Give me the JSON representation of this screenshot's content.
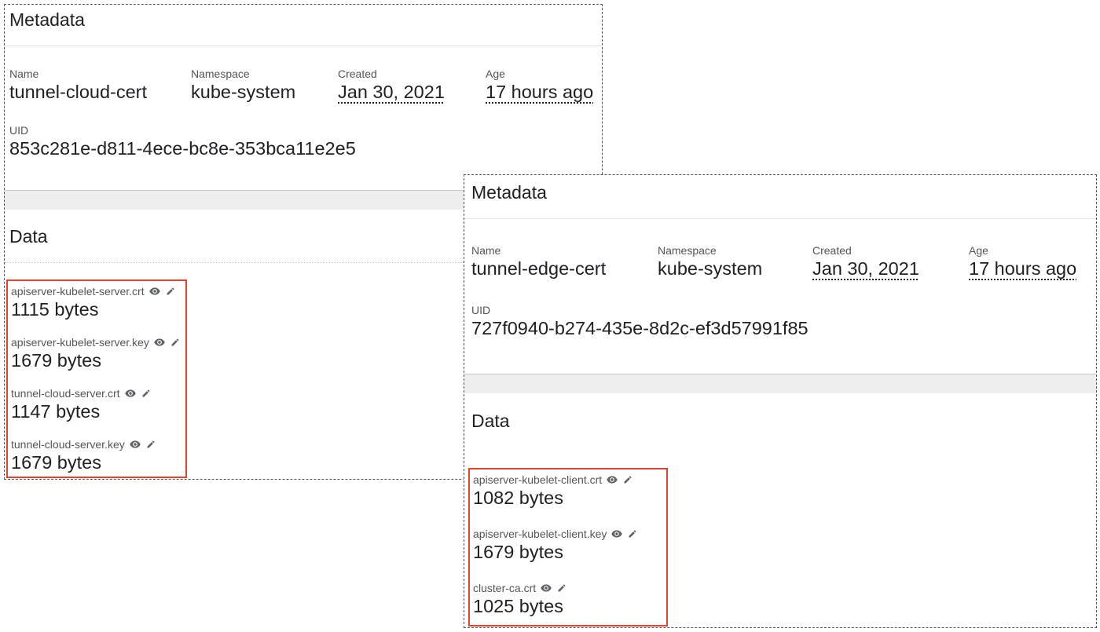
{
  "panels": [
    {
      "metadata_title": "Metadata",
      "name_label": "Name",
      "name": "tunnel-cloud-cert",
      "namespace_label": "Namespace",
      "namespace": "kube-system",
      "created_label": "Created",
      "created": "Jan 30, 2021",
      "age_label": "Age",
      "age": "17 hours ago",
      "uid_label": "UID",
      "uid": "853c281e-d811-4ece-bc8e-353bca11e2e5",
      "data_title": "Data",
      "entries": [
        {
          "key": "apiserver-kubelet-server.crt",
          "size": "1115 bytes"
        },
        {
          "key": "apiserver-kubelet-server.key",
          "size": "1679 bytes"
        },
        {
          "key": "tunnel-cloud-server.crt",
          "size": "1147 bytes"
        },
        {
          "key": "tunnel-cloud-server.key",
          "size": "1679 bytes"
        }
      ]
    },
    {
      "metadata_title": "Metadata",
      "name_label": "Name",
      "name": "tunnel-edge-cert",
      "namespace_label": "Namespace",
      "namespace": "kube-system",
      "created_label": "Created",
      "created": "Jan 30, 2021",
      "age_label": "Age",
      "age": "17 hours ago",
      "uid_label": "UID",
      "uid": "727f0940-b274-435e-8d2c-ef3d57991f85",
      "data_title": "Data",
      "entries": [
        {
          "key": "apiserver-kubelet-client.crt",
          "size": "1082 bytes"
        },
        {
          "key": "apiserver-kubelet-client.key",
          "size": "1679 bytes"
        },
        {
          "key": "cluster-ca.crt",
          "size": "1025 bytes"
        }
      ]
    }
  ],
  "icons": {
    "view": "eye-icon",
    "edit": "pencil-icon"
  },
  "colors": {
    "highlight_border": "#e2452e",
    "panel_border": "#555555",
    "band": "#eeeeee"
  }
}
